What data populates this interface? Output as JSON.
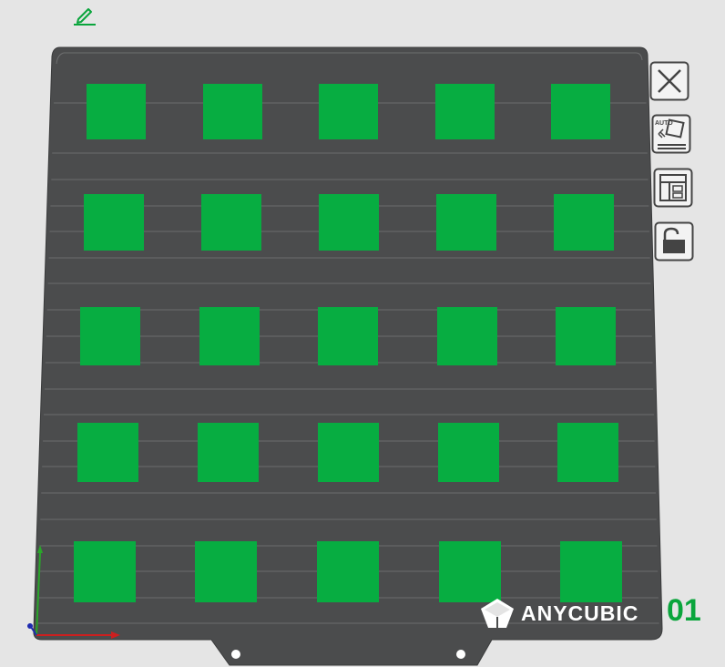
{
  "plate": {
    "brand_name": "ANYCUBIC",
    "number": "01",
    "bed_color": "#4b4c4d",
    "object_color": "#07ad41",
    "accent_color": "#0aa53c"
  },
  "objects": {
    "count_rows": 5,
    "count_cols": 5,
    "shape": "square"
  },
  "toolbar": {
    "edit_icon": "pencil-icon",
    "buttons": [
      {
        "name": "close-button",
        "icon": "close-x-icon"
      },
      {
        "name": "auto-orient-button",
        "icon": "auto-orient-icon",
        "badge": "AUTO"
      },
      {
        "name": "arrange-button",
        "icon": "layout-icon"
      },
      {
        "name": "lock-button",
        "icon": "unlocked-padlock-icon"
      }
    ]
  },
  "axes": {
    "x_color": "#cc1f1f",
    "y_color": "#2aa62a",
    "z_color": "#1e2bb0"
  }
}
